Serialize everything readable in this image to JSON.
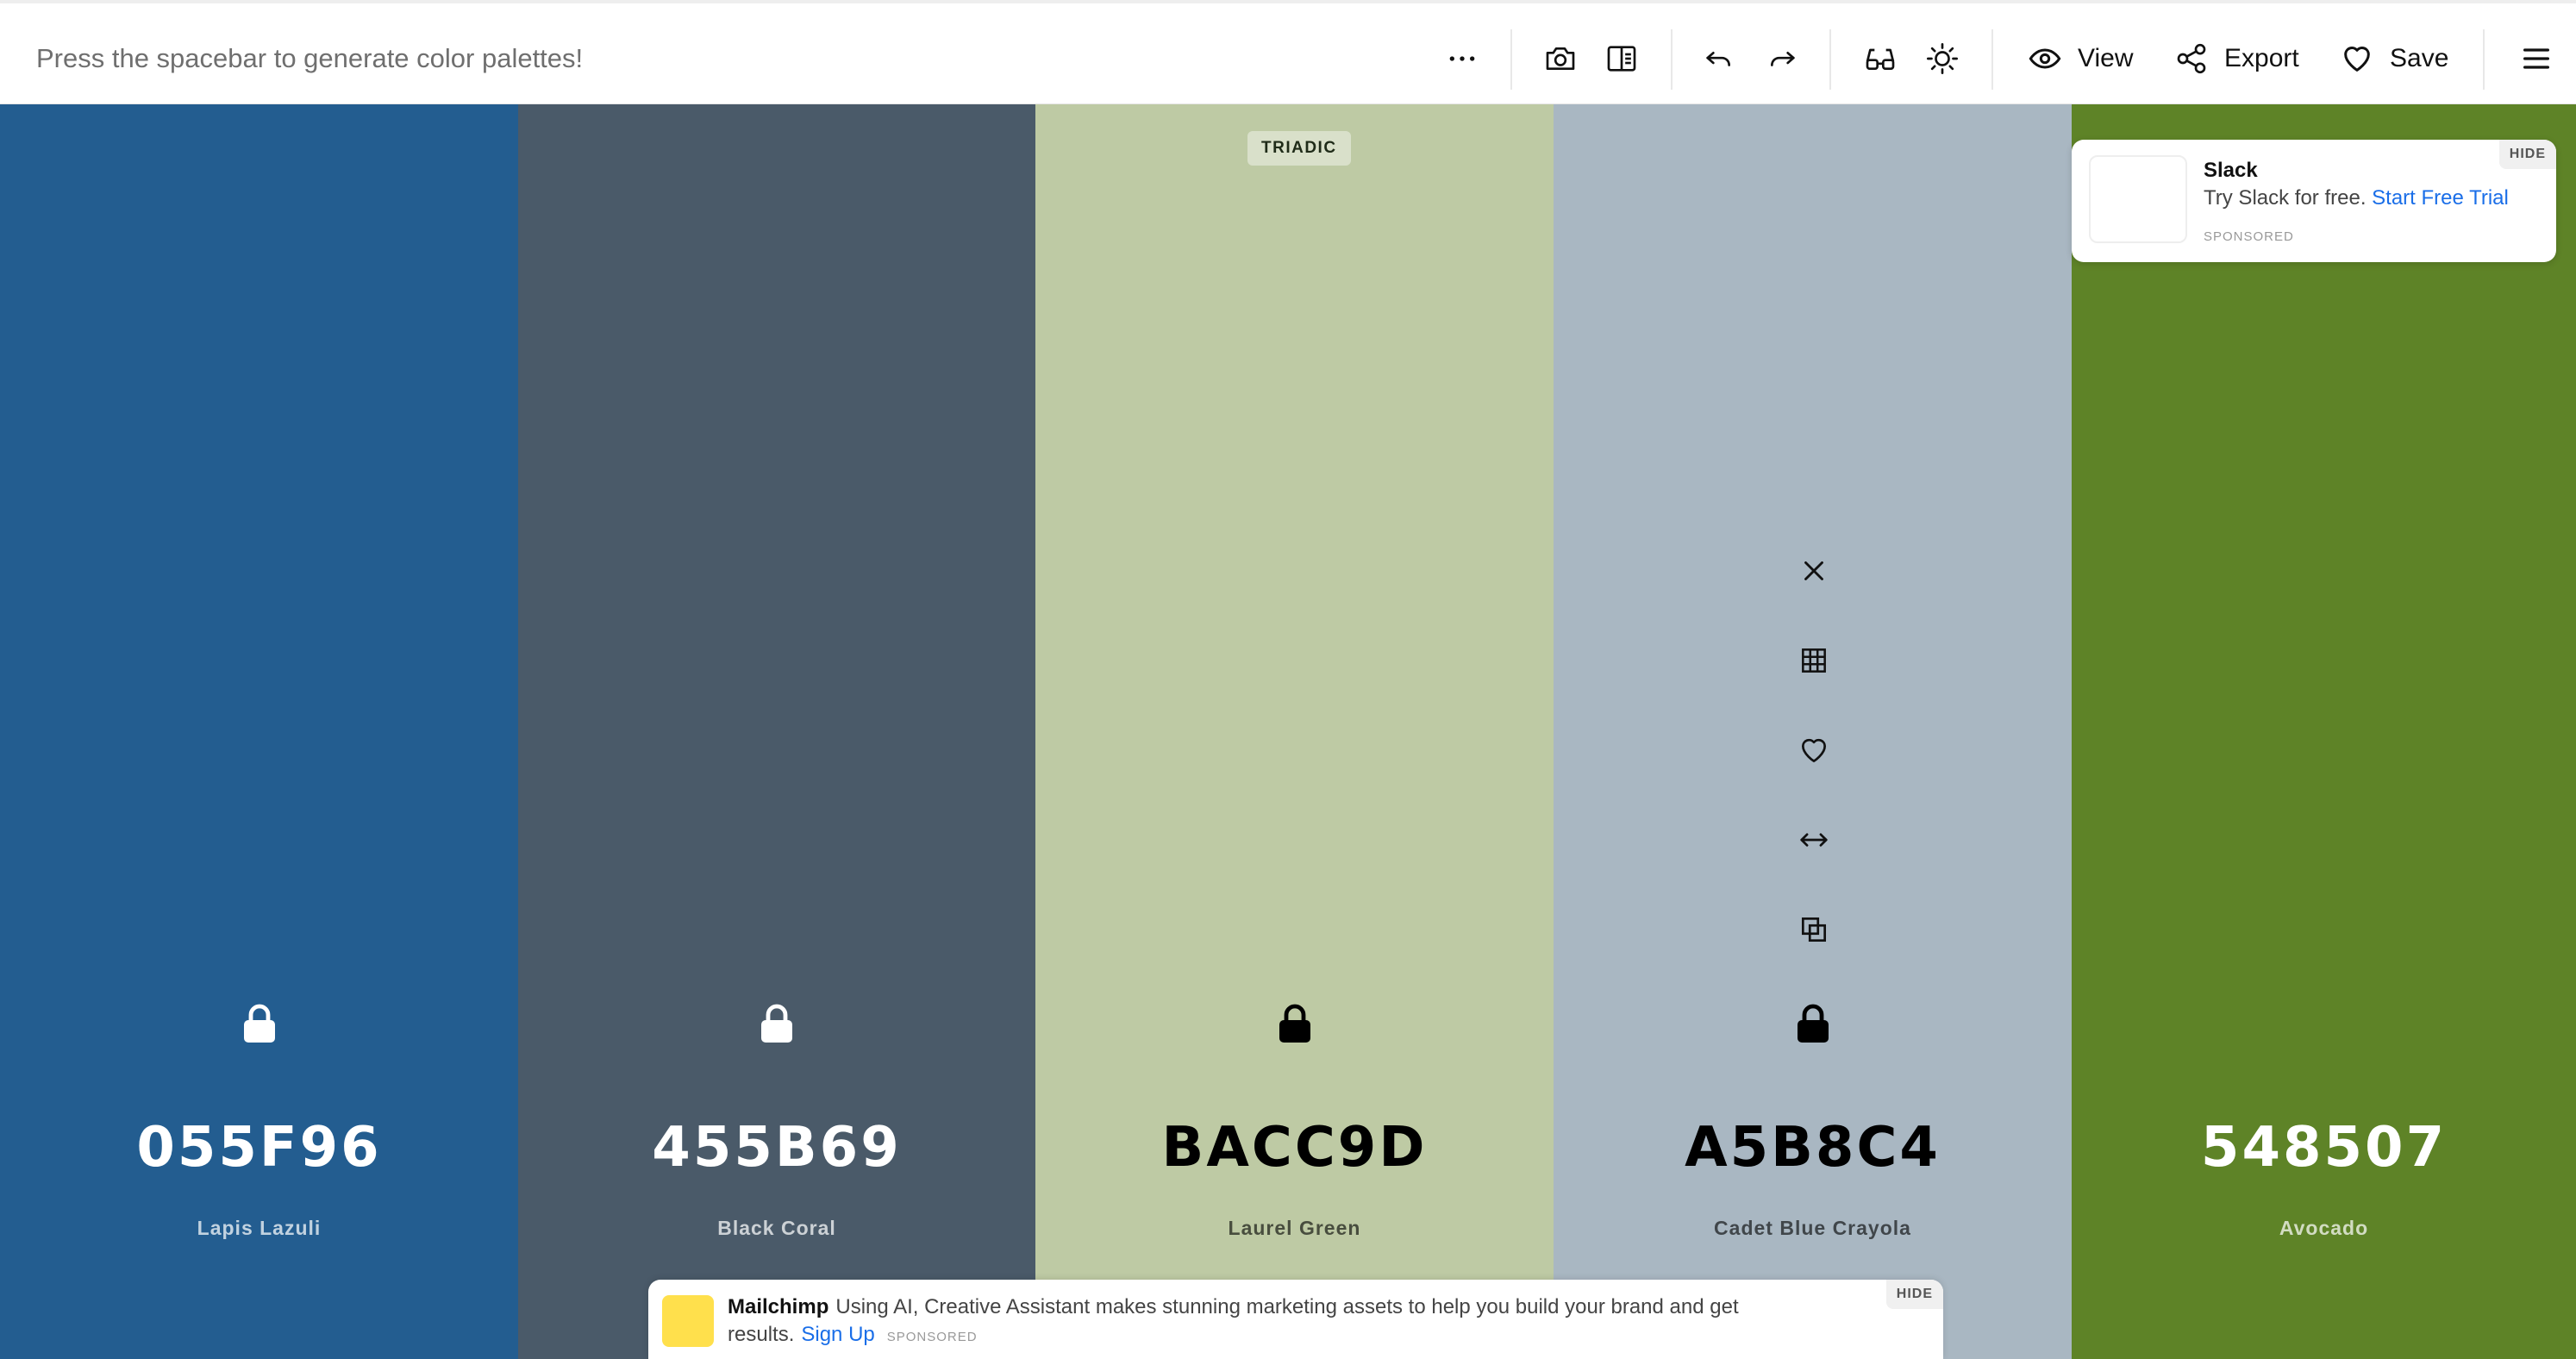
{
  "toolbar": {
    "hint": "Press the spacebar to generate color palettes!",
    "icons": [
      "more-icon",
      "camera-icon",
      "panel-icon",
      "undo-icon",
      "redo-icon",
      "glasses-icon",
      "sun-icon"
    ],
    "view_label": "View",
    "export_label": "Export",
    "save_label": "Save"
  },
  "palette": {
    "badge": "TRIADIC",
    "colors": [
      {
        "hex": "055F96",
        "name": "Lapis Lazuli",
        "bg": "#235D90",
        "text_tone": "light"
      },
      {
        "hex": "455B69",
        "name": "Black Coral",
        "bg": "#4A5A69",
        "text_tone": "light"
      },
      {
        "hex": "BACC9D",
        "name": "Laurel Green",
        "bg": "#BECAA4",
        "text_tone": "dark"
      },
      {
        "hex": "A5B8C4",
        "name": "Cadet Blue Crayola",
        "bg": "#A9B7C2",
        "text_tone": "dark"
      },
      {
        "hex": "548507",
        "name": "Avocado",
        "bg": "#5E8327",
        "text_tone": "light"
      }
    ],
    "column_tools": [
      "close-icon",
      "grid-icon",
      "heart-icon",
      "drag-arrows-icon",
      "copy-icon"
    ]
  },
  "ads": {
    "slack": {
      "title": "Slack",
      "text": "Try Slack for free.",
      "cta": "Start Free Trial",
      "sponsored": "SPONSORED",
      "hide": "HIDE"
    },
    "mailchimp": {
      "title": "Mailchimp",
      "text": "Using AI, Creative Assistant makes stunning marketing assets to help you build your brand and get results.",
      "cta": "Sign Up",
      "sponsored": "SPONSORED",
      "hide": "HIDE",
      "logo_color": "#FFE04C"
    }
  }
}
